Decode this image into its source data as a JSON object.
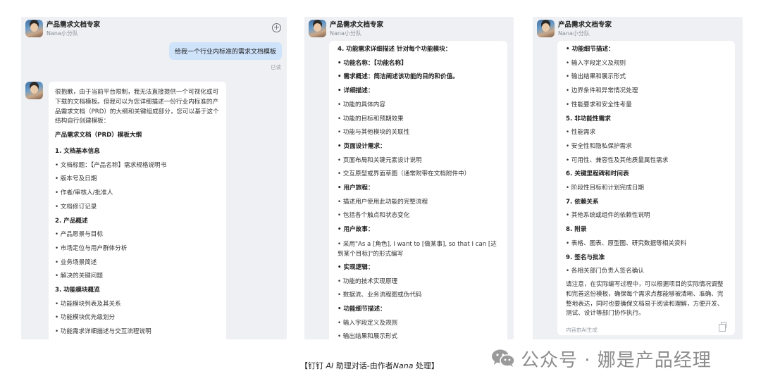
{
  "header": {
    "title": "产品需求文档专家",
    "subtitle": "Nana小分队"
  },
  "panel1": {
    "user_message": "给我一个行业内标准的需求文档模板",
    "read_status": "已读",
    "intro": "很抱歉，由于当前平台限制，我无法直接提供一个可视化或可下载的文档模板。但我可以为您详细描述一份行业内标准的产品需求文档（PRD）的大纲和关键组成部分，您可以基于这个结构自行创建模板：",
    "outline_title": "产品需求文档（PRD）模板大纲",
    "lines": [
      {
        "t": "1. 文档基本信息",
        "h": true
      },
      {
        "t": "• 文档标题：【产品名称】需求规格说明书",
        "h": false
      },
      {
        "t": "• 版本号及日期",
        "h": false
      },
      {
        "t": "• 作者/审核人/批准人",
        "h": false
      },
      {
        "t": "• 文档修订记录",
        "h": false
      },
      {
        "t": "2. 产品概述",
        "h": true
      },
      {
        "t": "• 产品愿景与目标",
        "h": false
      },
      {
        "t": "• 市场定位与用户群体分析",
        "h": false
      },
      {
        "t": "• 业务场景简述",
        "h": false
      },
      {
        "t": "• 解决的关键问题",
        "h": false
      },
      {
        "t": "3. 功能模块概览",
        "h": true
      },
      {
        "t": "• 功能模块列表及其关系",
        "h": false
      },
      {
        "t": "• 功能模块优先级划分",
        "h": false
      },
      {
        "t": "• 功能需求详细描述与交互流程说明",
        "h": false
      }
    ]
  },
  "panel2": {
    "lines": [
      {
        "t": "4. 功能需求详细描述 针对每个功能模块：",
        "h": true
      },
      {
        "t": "• 功能名称：【功能名称】",
        "h": true
      },
      {
        "t": "• 需求概述：简洁阐述该功能的目的和价值。",
        "h": true
      },
      {
        "t": "• 详细描述：",
        "h": true
      },
      {
        "t": "• 功能的具体内容",
        "h": false
      },
      {
        "t": "• 功能的目标和预期效果",
        "h": false
      },
      {
        "t": "• 功能与其他模块的关联性",
        "h": false
      },
      {
        "t": "• 页面设计需求：",
        "h": true
      },
      {
        "t": "• 页面布局和关键元素设计说明",
        "h": false
      },
      {
        "t": "• 交互原型或界面草图（通常附带在文档附件中）",
        "h": false
      },
      {
        "t": "• 用户旅程：",
        "h": true
      },
      {
        "t": "• 描述用户使用此功能的完整流程",
        "h": false
      },
      {
        "t": "• 包括各个触点和状态变化",
        "h": false
      },
      {
        "t": "• 用户故事：",
        "h": true
      },
      {
        "t": "• 采用\"As a [角色], I want to [做某事], so that I can [达到某个目标]\"的形式编写",
        "h": false,
        "wrap": true
      },
      {
        "t": "• 实现逻辑：",
        "h": true
      },
      {
        "t": "• 功能的技术实现原理",
        "h": false
      },
      {
        "t": "• 数据流、业务流程图或伪代码",
        "h": false
      },
      {
        "t": "• 功能细节描述：",
        "h": true
      },
      {
        "t": "• 输入字段定义及规则",
        "h": false
      },
      {
        "t": "• 输出结果和展示形式",
        "h": false
      }
    ]
  },
  "panel3": {
    "lines": [
      {
        "t": "• 功能细节描述：",
        "h": true
      },
      {
        "t": "• 输入字段定义及规则",
        "h": false
      },
      {
        "t": "• 输出结果和展示形式",
        "h": false
      },
      {
        "t": "• 边界条件和异常情况处理",
        "h": false
      },
      {
        "t": "• 性能要求和安全性考量",
        "h": false
      },
      {
        "t": "5. 非功能性需求",
        "h": true
      },
      {
        "t": "• 性能需求",
        "h": false
      },
      {
        "t": "• 安全性和隐私保护需求",
        "h": false
      },
      {
        "t": "• 可用性、兼容性及其他质量属性需求",
        "h": false
      },
      {
        "t": "6. 关键里程碑和时间表",
        "h": true
      },
      {
        "t": "• 阶段性目标和计划完成日期",
        "h": false
      },
      {
        "t": "7. 依赖关系",
        "h": true
      },
      {
        "t": "• 其他系统或组件的依赖性说明",
        "h": false
      },
      {
        "t": "8. 附录",
        "h": true
      },
      {
        "t": "• 表格、图表、原型图、研究数据等相关资料",
        "h": false
      },
      {
        "t": "9. 签名与批准",
        "h": true
      },
      {
        "t": "• 各相关部门负责人签名确认",
        "h": false
      }
    ],
    "closing": "请注意，在实际编写过程中，可以根据项目的实际情况调整和完善这份模板，确保每个需求点都能够被清晰、准确、完整地表达，同时也要确保文档易于阅读和理解，方便开发、测试、设计等部门协作执行。",
    "ai_note": "内容由AI生成"
  },
  "caption": {
    "prefix": "【钉钉 ",
    "ai": "AI",
    "mid": " 助理对话-由作者",
    "author": "Nana",
    "suffix": " 处理】"
  },
  "brand": {
    "text": "公众号 · 娜是产品经理",
    "icon": "wechat-icon"
  }
}
